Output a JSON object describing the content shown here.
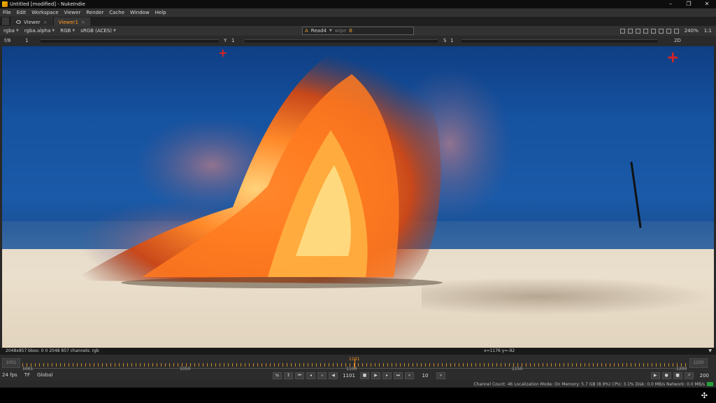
{
  "window": {
    "title": "Untitled [modified] - NukeIndie",
    "controls": [
      "–",
      "❐",
      "✕"
    ]
  },
  "menu": [
    "File",
    "Edit",
    "Workspace",
    "Viewer",
    "Render",
    "Cache",
    "Window",
    "Help"
  ],
  "tabs": [
    {
      "label": "Viewer",
      "close": "×"
    },
    {
      "label": "Viewer1",
      "close": "×"
    }
  ],
  "toolbar": {
    "channels": "rgba",
    "alpha": "rgba.alpha",
    "colorspace": "RGB",
    "view_transform": "sRGB (ACES)",
    "input_a_prefix": "A",
    "input_a": "Read4",
    "wipe": "wipe",
    "input_b": "B",
    "zoom": "240%",
    "ratio": "1:1",
    "mode": "2D"
  },
  "sliders": {
    "fstop": "f/8",
    "gain": "1",
    "gamma_label": "Y",
    "gamma": "1",
    "saturation_label": "S",
    "saturation": "1"
  },
  "info": {
    "format": "2048x857  bbox: 0 0 2048 857 channels: rgb",
    "coords": "x=1176 y=-92"
  },
  "timeline": {
    "start_box": "1001",
    "end_box": "1200",
    "start": "1001",
    "mid1": "1050",
    "mid2": "1100",
    "mid3": "1150",
    "end": "1200",
    "current": "1101",
    "current_fraction": 0.5
  },
  "controls": {
    "fps": "24 fps",
    "tf": "TF",
    "global": "Global",
    "frame": "1101",
    "skip": "10",
    "end_frame": "200"
  },
  "status": {
    "text": "Channel Count: 46  Localization Mode: On  Memory: 5.7 GB (8.9%)  CPU: 3.1%  Disk: 0.0 MB/s  Network: 0.0 MB/s"
  },
  "colors": {
    "accent": "#ff9a22",
    "crosshair": "#dd2222"
  }
}
